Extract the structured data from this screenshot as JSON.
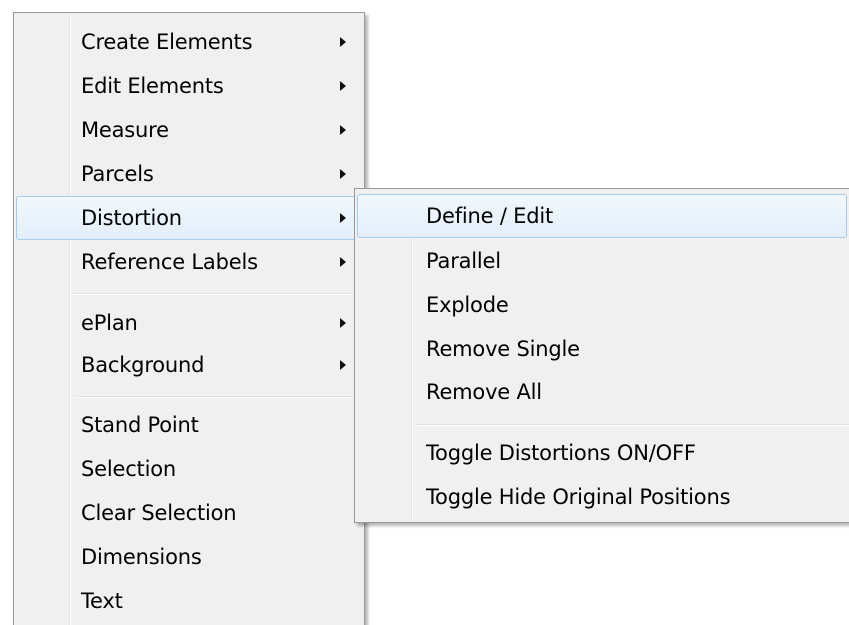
{
  "main_menu": {
    "items": [
      {
        "label": "Create Elements",
        "has_submenu": true
      },
      {
        "label": "Edit Elements",
        "has_submenu": true
      },
      {
        "label": "Measure",
        "has_submenu": true
      },
      {
        "label": "Parcels",
        "has_submenu": true
      },
      {
        "label": "Distortion",
        "has_submenu": true,
        "highlighted": true
      },
      {
        "label": "Reference Labels",
        "has_submenu": true
      },
      {
        "label": "ePlan",
        "has_submenu": true
      },
      {
        "label": "Background",
        "has_submenu": true
      },
      {
        "label": "Stand Point",
        "has_submenu": false
      },
      {
        "label": "Selection",
        "has_submenu": false
      },
      {
        "label": "Clear Selection",
        "has_submenu": false
      },
      {
        "label": "Dimensions",
        "has_submenu": false
      },
      {
        "label": "Text",
        "has_submenu": false
      }
    ]
  },
  "distortion_submenu": {
    "items": [
      {
        "label": "Define / Edit",
        "highlighted": true
      },
      {
        "label": "Parallel"
      },
      {
        "label": "Explode"
      },
      {
        "label": "Remove Single"
      },
      {
        "label": "Remove All"
      },
      {
        "label": "Toggle Distortions ON/OFF"
      },
      {
        "label": "Toggle Hide Original Positions"
      }
    ]
  },
  "colors": {
    "menu_background": "#f0f0f0",
    "highlight_border": "#a8cbf0",
    "highlight_fill": "#e3eefb"
  }
}
